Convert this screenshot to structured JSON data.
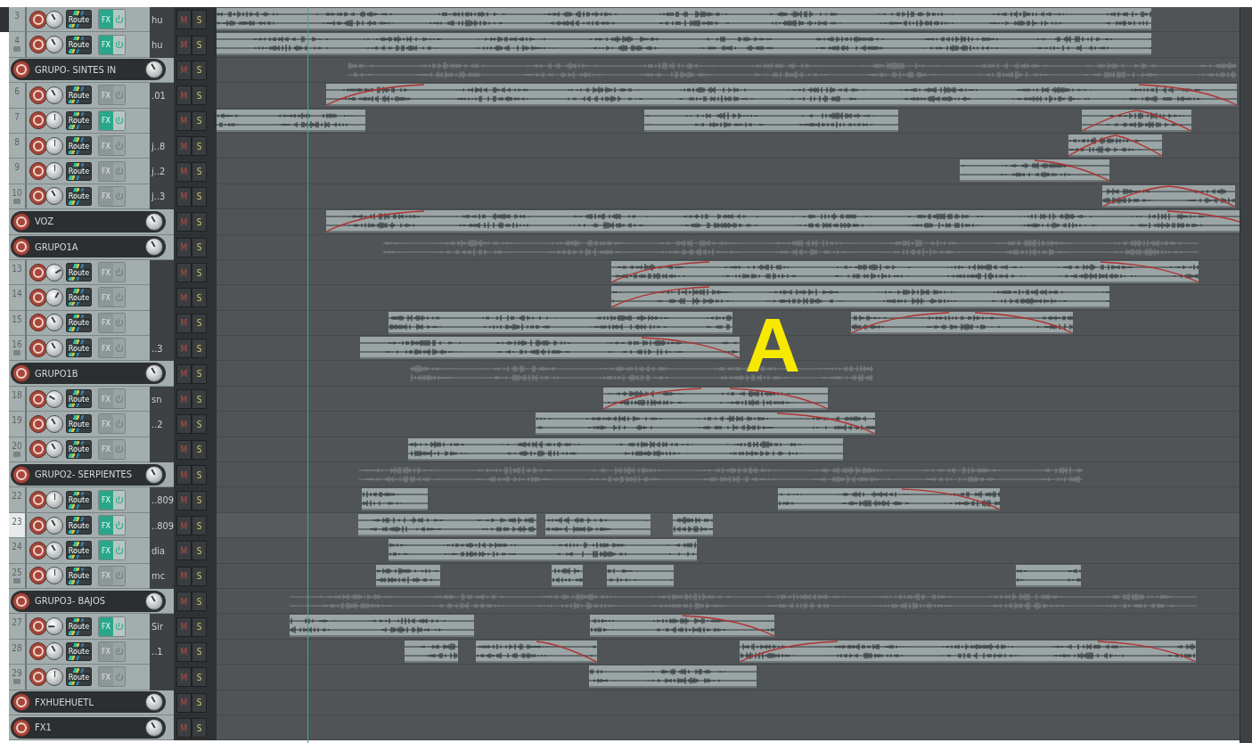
{
  "tracks": [
    {
      "kind": "track",
      "number": "3",
      "name": "hu",
      "fx_on": true,
      "selected": false,
      "folder_end": false,
      "route": "Route",
      "fx": "FX",
      "mute": "M",
      "solo": "S"
    },
    {
      "kind": "track",
      "number": "4",
      "name": "hu",
      "fx_on": true,
      "selected": false,
      "folder_end": true,
      "route": "Route",
      "fx": "FX",
      "mute": "M",
      "solo": "S"
    },
    {
      "kind": "folder",
      "name": "GRUPO- SINTES IN",
      "selected": false,
      "mute": "M",
      "solo": "S"
    },
    {
      "kind": "track",
      "number": "6",
      "name": ".01",
      "fx_on": false,
      "selected": false,
      "folder_end": false,
      "route": "Route",
      "fx": "FX",
      "mute": "M",
      "solo": "S"
    },
    {
      "kind": "track",
      "number": "7",
      "fx_on": true,
      "selected": false,
      "folder_end": false,
      "route": "Route",
      "fx": "FX",
      "mute": "M",
      "solo": "S"
    },
    {
      "kind": "track",
      "number": "8",
      "name": "j..8",
      "fx_on": false,
      "selected": false,
      "folder_end": false,
      "route": "Route",
      "fx": "FX",
      "mute": "M",
      "solo": "S"
    },
    {
      "kind": "track",
      "number": "9",
      "name": "j..2",
      "fx_on": false,
      "selected": false,
      "folder_end": false,
      "route": "Route",
      "fx": "FX",
      "mute": "M",
      "solo": "S"
    },
    {
      "kind": "track",
      "number": "10",
      "name": "j..3",
      "fx_on": false,
      "selected": false,
      "folder_end": true,
      "route": "Route",
      "fx": "FX",
      "mute": "M",
      "solo": "S"
    },
    {
      "kind": "folder",
      "name": "VOZ",
      "selected": false,
      "mute": "M",
      "solo": "S"
    },
    {
      "kind": "folder",
      "name": "GRUPO1A",
      "selected": false,
      "mute": "M",
      "solo": "S"
    },
    {
      "kind": "track",
      "number": "13",
      "fx_on": false,
      "selected": false,
      "folder_end": false,
      "route": "Route",
      "fx": "FX",
      "mute": "M",
      "solo": "S"
    },
    {
      "kind": "track",
      "number": "14",
      "fx_on": false,
      "selected": false,
      "folder_end": false,
      "route": "Route",
      "fx": "FX",
      "mute": "M",
      "solo": "S"
    },
    {
      "kind": "track",
      "number": "15",
      "fx_on": false,
      "selected": false,
      "folder_end": false,
      "route": "Route",
      "fx": "FX",
      "mute": "M",
      "solo": "S"
    },
    {
      "kind": "track",
      "number": "16",
      "name": "..3",
      "fx_on": false,
      "selected": false,
      "folder_end": true,
      "route": "Route",
      "fx": "FX",
      "mute": "M",
      "solo": "S"
    },
    {
      "kind": "folder",
      "name": "GRUPO1B",
      "selected": false,
      "mute": "M",
      "solo": "S"
    },
    {
      "kind": "track",
      "number": "18",
      "name": "sn",
      "fx_on": false,
      "selected": false,
      "folder_end": false,
      "route": "Route",
      "fx": "FX",
      "mute": "M",
      "solo": "S"
    },
    {
      "kind": "track",
      "number": "19",
      "name": "..2",
      "fx_on": false,
      "selected": false,
      "folder_end": false,
      "route": "Route",
      "fx": "FX",
      "mute": "M",
      "solo": "S"
    },
    {
      "kind": "track",
      "number": "20",
      "fx_on": false,
      "selected": false,
      "folder_end": true,
      "route": "Route",
      "fx": "FX",
      "mute": "M",
      "solo": "S"
    },
    {
      "kind": "folder",
      "name": "GRUPO2- SERPIENTES",
      "selected": false,
      "mute": "M",
      "solo": "S"
    },
    {
      "kind": "track",
      "number": "22",
      "name": "..809",
      "fx_on": true,
      "selected": false,
      "folder_end": false,
      "route": "Route",
      "fx": "FX",
      "mute": "M",
      "solo": "S"
    },
    {
      "kind": "track",
      "number": "23",
      "name": "..809",
      "fx_on": true,
      "selected": true,
      "folder_end": false,
      "route": "Route",
      "fx": "FX",
      "mute": "M",
      "solo": "S"
    },
    {
      "kind": "track",
      "number": "24",
      "name": "dia",
      "fx_on": true,
      "selected": false,
      "folder_end": false,
      "route": "Route",
      "fx": "FX",
      "mute": "M",
      "solo": "S"
    },
    {
      "kind": "track",
      "number": "25",
      "name": "mc",
      "fx_on": false,
      "selected": false,
      "folder_end": true,
      "route": "Route",
      "fx": "FX",
      "mute": "M",
      "solo": "S"
    },
    {
      "kind": "folder",
      "name": "GRUPO3- BAJOS",
      "selected": false,
      "mute": "M",
      "solo": "S"
    },
    {
      "kind": "track",
      "number": "27",
      "name": "Sir",
      "fx_on": true,
      "selected": false,
      "folder_end": false,
      "route": "Route",
      "fx": "FX",
      "mute": "M",
      "solo": "S"
    },
    {
      "kind": "track",
      "number": "28",
      "name": "..1",
      "fx_on": false,
      "selected": false,
      "folder_end": false,
      "route": "Route",
      "fx": "FX",
      "mute": "M",
      "solo": "S"
    },
    {
      "kind": "track",
      "number": "29",
      "fx_on": false,
      "selected": false,
      "folder_end": true,
      "route": "Route",
      "fx": "FX",
      "mute": "M",
      "solo": "S"
    },
    {
      "kind": "folder",
      "name": "FXHUEHUETL",
      "selected": false,
      "mute": "M",
      "solo": "S"
    },
    {
      "kind": "folder",
      "name": "FX1",
      "selected": false,
      "mute": "M",
      "solo": "S"
    }
  ],
  "overlay_label": "A"
}
